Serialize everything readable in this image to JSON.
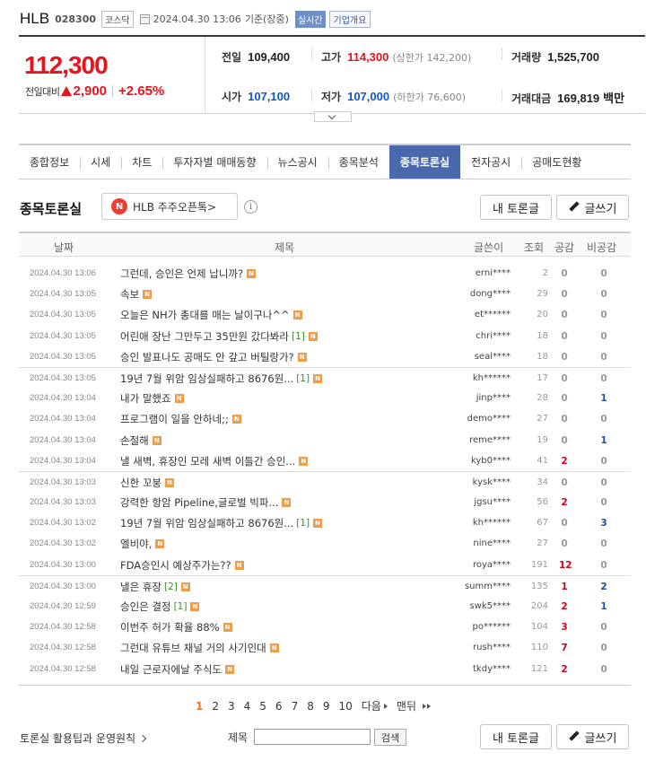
{
  "header": {
    "name": "HLB",
    "code": "028300",
    "market": "코스닥",
    "datetime": "2024.04.30 13:06",
    "basis": "기준(장중)",
    "realtime": "실시간",
    "company_info": "기업개요"
  },
  "quote": {
    "price": "112,300",
    "change_label": "전일대비",
    "change_amount": "2,900",
    "change_pct": "+2.65%",
    "prev_label": "전일",
    "prev": "109,400",
    "high_label": "고가",
    "high": "114,300",
    "upper_limit": "(상한가 142,200)",
    "volume_label": "거래량",
    "volume": "1,525,700",
    "open_label": "시가",
    "open": "107,100",
    "low_label": "저가",
    "low": "107,000",
    "lower_limit": "(하한가 76,600)",
    "amount_label": "거래대금",
    "amount": "169,819",
    "amount_unit": "백만"
  },
  "tabs": [
    "종합정보",
    "시세",
    "차트",
    "투자자별 매매동향",
    "뉴스공시",
    "종목분석",
    "종목토론실",
    "전자공시",
    "공매도현황"
  ],
  "board": {
    "title": "종목토론실",
    "open_talk_badge": "N",
    "open_talk": "HLB 주주오픈톡>",
    "info": "i",
    "my_discussion": "내 토론글",
    "write": "글쓰기"
  },
  "columns": {
    "date": "날짜",
    "title": "제목",
    "writer": "글쓴이",
    "views": "조회",
    "like": "공감",
    "dislike": "비공감"
  },
  "posts": [
    {
      "date": "2024.04.30 13:06",
      "title": "그런데, 승인은 언제 납니까?",
      "comments": "",
      "writer": "erni****",
      "views": "2",
      "like": "0",
      "dislike": "0"
    },
    {
      "date": "2024.04.30 13:05",
      "title": "속보",
      "comments": "",
      "writer": "dong****",
      "views": "29",
      "like": "0",
      "dislike": "0"
    },
    {
      "date": "2024.04.30 13:05",
      "title": "오늘은 NH가 총대를 매는 날이구나^^",
      "comments": "",
      "writer": "et******",
      "views": "20",
      "like": "0",
      "dislike": "0"
    },
    {
      "date": "2024.04.30 13:05",
      "title": "어린애 장난 그만두고 35만원 갔다봐라",
      "comments": "[1]",
      "writer": "chri****",
      "views": "18",
      "like": "0",
      "dislike": "0"
    },
    {
      "date": "2024.04.30 13:05",
      "title": "승인 발표나도 공매도 안 갚고 버틸랑가?",
      "comments": "",
      "writer": "seal****",
      "views": "18",
      "like": "0",
      "dislike": "0"
    },
    {
      "date": "2024.04.30 13:05",
      "title": "19년 7월 위암 임상실패하고 8676원...",
      "comments": "[1]",
      "writer": "kh******",
      "views": "17",
      "like": "0",
      "dislike": "0"
    },
    {
      "date": "2024.04.30 13:04",
      "title": "내가 말했죠",
      "comments": "",
      "writer": "jinp****",
      "views": "28",
      "like": "0",
      "dislike": "1"
    },
    {
      "date": "2024.04.30 13:04",
      "title": "프로그램이 일을 안하네;;",
      "comments": "",
      "writer": "demo****",
      "views": "27",
      "like": "0",
      "dislike": "0"
    },
    {
      "date": "2024.04.30 13:04",
      "title": "손절해",
      "comments": "",
      "writer": "reme****",
      "views": "19",
      "like": "0",
      "dislike": "1"
    },
    {
      "date": "2024.04.30 13:04",
      "title": "낼 새벽, 휴장인 모레 새벽 이틀간 승인...",
      "comments": "",
      "writer": "kyb0****",
      "views": "41",
      "like": "2",
      "dislike": "0"
    },
    {
      "date": "2024.04.30 13:03",
      "title": "신한 꼬붕",
      "comments": "",
      "writer": "kysk****",
      "views": "34",
      "like": "0",
      "dislike": "0"
    },
    {
      "date": "2024.04.30 13:03",
      "title": "강력한 항암 Pipeline,글로벌 빅파...",
      "comments": "",
      "writer": "jgsu****",
      "views": "56",
      "like": "2",
      "dislike": "0"
    },
    {
      "date": "2024.04.30 13:02",
      "title": "19년 7월 위암 임상실패하고 8676원...",
      "comments": "[1]",
      "writer": "kh******",
      "views": "67",
      "like": "0",
      "dislike": "3"
    },
    {
      "date": "2024.04.30 13:02",
      "title": "엘비야,",
      "comments": "",
      "writer": "nine****",
      "views": "27",
      "like": "0",
      "dislike": "0"
    },
    {
      "date": "2024.04.30 13:00",
      "title": "FDA승인시 예상주가는??",
      "comments": "",
      "writer": "roya****",
      "views": "191",
      "like": "12",
      "dislike": "0"
    },
    {
      "date": "2024.04.30 13:00",
      "title": "낼은 휴장",
      "comments": "[2]",
      "writer": "summ****",
      "views": "135",
      "like": "1",
      "dislike": "2"
    },
    {
      "date": "2024.04.30 12:59",
      "title": "승인은 결정",
      "comments": "[1]",
      "writer": "swk5****",
      "views": "204",
      "like": "2",
      "dislike": "1"
    },
    {
      "date": "2024.04.30 12:58",
      "title": "이번주 허가 확율 88%",
      "comments": "",
      "writer": "po******",
      "views": "104",
      "like": "3",
      "dislike": "0"
    },
    {
      "date": "2024.04.30 12:58",
      "title": "그런대 유튜브 채널 거의 사기인대",
      "comments": "",
      "writer": "rush****",
      "views": "110",
      "like": "7",
      "dislike": "0"
    },
    {
      "date": "2024.04.30 12:58",
      "title": "내일 근로자에날 주식도",
      "comments": "",
      "writer": "tkdy****",
      "views": "121",
      "like": "2",
      "dislike": "0"
    }
  ],
  "new_badge": "N",
  "pagination": {
    "pages": [
      "1",
      "2",
      "3",
      "4",
      "5",
      "6",
      "7",
      "8",
      "9",
      "10"
    ],
    "current": "1",
    "next": "다음",
    "last": "맨뒤"
  },
  "footer": {
    "tips": "토론실 활용팁과 운영원칙",
    "search_label": "제목",
    "search_value": "",
    "search_button": "검색",
    "my_discussion": "내 토론글",
    "write": "글쓰기"
  },
  "colors": {
    "up": "#e8131c",
    "down": "#1157c9",
    "active_tab": "#4a69ac",
    "new_badge": "#f09d4b",
    "current_page": "#f5761a"
  }
}
